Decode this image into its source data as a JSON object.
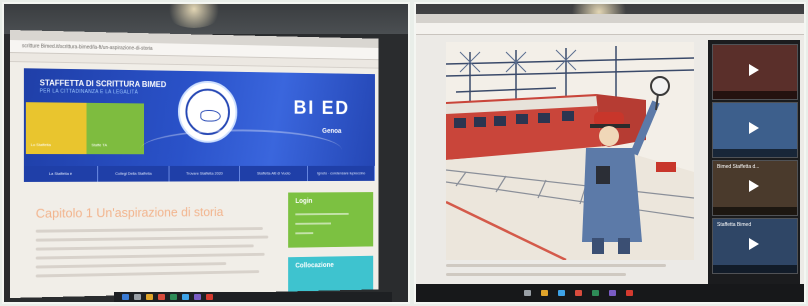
{
  "left_photo": {
    "address_bar": "scritture Bimed.it/scrittura-bimed/la-ft/un-aspirazione-di-storia",
    "site": {
      "title": "STAFFETTA DI SCRITTURA BIMED",
      "subtitle": "PER LA CITTADINANZA E LA LEGALITÀ",
      "logo_text": "BI  ED",
      "logo_sub": "Genoa",
      "tiles": [
        "Lo Staffetta",
        "Staffe TA"
      ],
      "nav": [
        "La Staffetta è",
        "Collegi Della Staffetta",
        "Trovare Staffetta 2020",
        "Staffetta Alti di Vuoto",
        "Ignoto · condensare lupioccino"
      ],
      "chapter_title": "Capitolo 1 Un'aspirazione di storia",
      "side_green_title": "Login",
      "side_cyan_title": "Collocazione"
    },
    "colors": {
      "header_blue": "#2446b4",
      "tile_yellow": "#e9c52e",
      "tile_green": "#7ebc3f",
      "side_green": "#7cc141",
      "side_cyan": "#3ec3cf",
      "title_peach": "#f2b48d"
    }
  },
  "right_photo": {
    "videos": [
      {
        "title": ""
      },
      {
        "title": ""
      },
      {
        "title": "Bimed Staffetta d..."
      },
      {
        "title": "Staffetta Bimed"
      }
    ],
    "colors": {
      "cap_red": "#c8362b",
      "uniform_blue": "#5c7aa8",
      "rail_red": "#d45a4a"
    }
  }
}
